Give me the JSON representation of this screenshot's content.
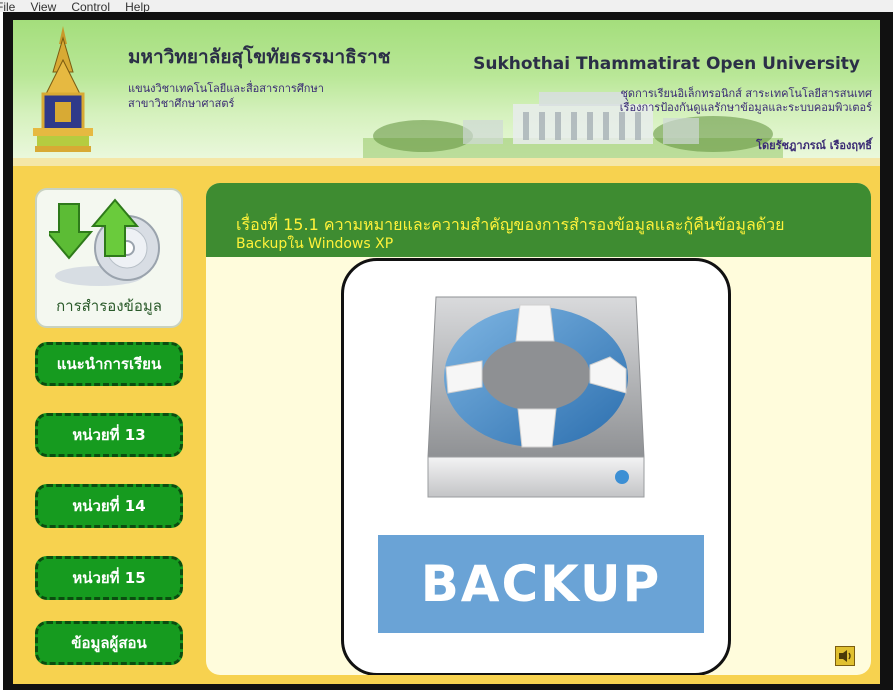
{
  "menu": {
    "items": [
      "File",
      "View",
      "Control",
      "Help"
    ]
  },
  "header": {
    "title_th": "มหาวิทยาลัยสุโขทัยธรรมาธิราช",
    "dept_line_1": "แขนงวิชาเทคโนโลยีและสื่อสารการศึกษา",
    "dept_line_2": "สาขาวิชาศึกษาศาสตร์",
    "title_en": "Sukhothai Thammatirat Open University",
    "course_line_1": "ชุดการเรียนอิเล็กทรอนิกส์ สาระเทคโนโลยีสารสนเทศ",
    "course_line_2": "เรื่องการป้องกันดูแลรักษาข้อมูลและระบบคอมพิวเตอร์",
    "author": "โดยรัชฎาภรณ์ เรืองฤทธิ์"
  },
  "sidebar": {
    "top_label": "การสำรองข้อมูล",
    "items": [
      {
        "label": "แนะนำการเรียน"
      },
      {
        "label": "หน่วยที่ 13"
      },
      {
        "label": "หน่วยที่ 14"
      },
      {
        "label": "หน่วยที่ 15"
      },
      {
        "label": "ข้อมูลผู้สอน"
      }
    ]
  },
  "content": {
    "title_line_1": "เรื่องที่ 15.1 ความหมายและความสำคัญของการสำรองข้อมูลและกู้คืนข้อมูลด้วย",
    "title_line_2": "Backupใน Windows XP",
    "banner_text": "BACKUP"
  },
  "icons": {
    "seal": "university-seal-icon",
    "backup": "backup-disc-icon",
    "lifebuoy": "lifebuoy-drive-icon",
    "speaker": "speaker-icon"
  },
  "colors": {
    "header_green": "#a4de7c",
    "body_yellow": "#f7d24f",
    "nav_green": "#169b1f",
    "title_bar_green": "#3e8c31",
    "title_yellow": "#fff23a",
    "banner_blue": "#6aa3d6"
  }
}
